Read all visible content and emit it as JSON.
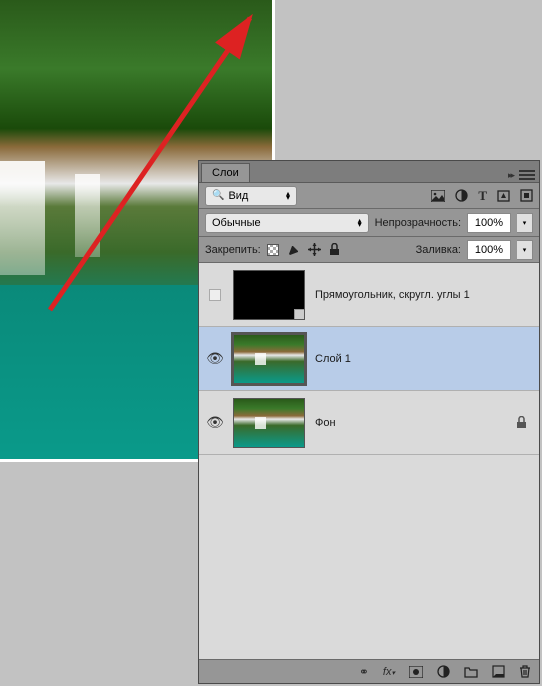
{
  "panel": {
    "title": "Слои",
    "search": {
      "icon": "🔍",
      "label": "Вид"
    },
    "toolbar_icons": [
      "image-icon",
      "adjustment-icon",
      "text-icon",
      "shape-icon",
      "smartobject-icon"
    ],
    "blend_mode": "Обычные",
    "opacity_label": "Непрозрачность:",
    "opacity_value": "100%",
    "fill_label": "Заливка:",
    "fill_value": "100%",
    "lock_label": "Закрепить:"
  },
  "layers": [
    {
      "visible": false,
      "thumb": "black-rect",
      "name": "Прямоугольник, скругл. углы 1",
      "selected": false,
      "locked": false
    },
    {
      "visible": true,
      "thumb": "waterfall",
      "name": "Слой 1",
      "selected": true,
      "locked": false
    },
    {
      "visible": true,
      "thumb": "waterfall",
      "name": "Фон",
      "selected": false,
      "locked": true
    }
  ],
  "footer_icons": [
    "link-icon",
    "fx-icon",
    "mask-icon",
    "adjustment-layer-icon",
    "group-icon",
    "new-layer-icon",
    "trash-icon"
  ]
}
